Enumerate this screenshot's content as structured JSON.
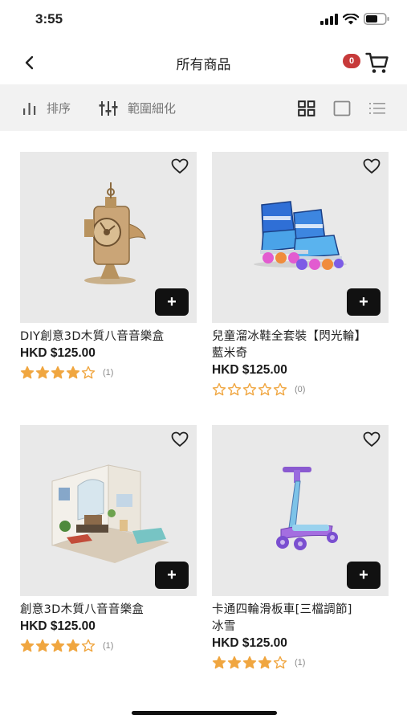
{
  "status_bar": {
    "time": "3:55"
  },
  "nav": {
    "title": "所有商品",
    "cart_count": "0"
  },
  "toolbar": {
    "sort_label": "排序",
    "filter_label": "範圍細化"
  },
  "products": [
    {
      "name_line1": "DIY創意3D木質八音音樂盒",
      "name_line2": "",
      "price": "HKD $125.00",
      "rating": 4,
      "review_count": "(1)",
      "image": "wooden-music-box-image"
    },
    {
      "name_line1": "兒童溜冰鞋全套裝【閃光輪】",
      "name_line2": "藍米奇",
      "price": "HKD $125.00",
      "rating": 0,
      "review_count": "(0)",
      "image": "inline-skates-image"
    },
    {
      "name_line1": "創意3D木質八音音樂盒",
      "name_line2": "",
      "price": "HKD $125.00",
      "rating": 4,
      "review_count": "(1)",
      "image": "dollhouse-image"
    },
    {
      "name_line1": "卡通四輪滑板車[三檔調節]",
      "name_line2": "冰雪",
      "price": "HKD $125.00",
      "rating": 4,
      "review_count": "(1)",
      "image": "kick-scooter-image"
    }
  ],
  "colors": {
    "accent_star": "#f0a640",
    "badge": "#c73a3a",
    "toolbar_bg": "#f2f2f2",
    "card_bg": "#e9e9e9"
  }
}
